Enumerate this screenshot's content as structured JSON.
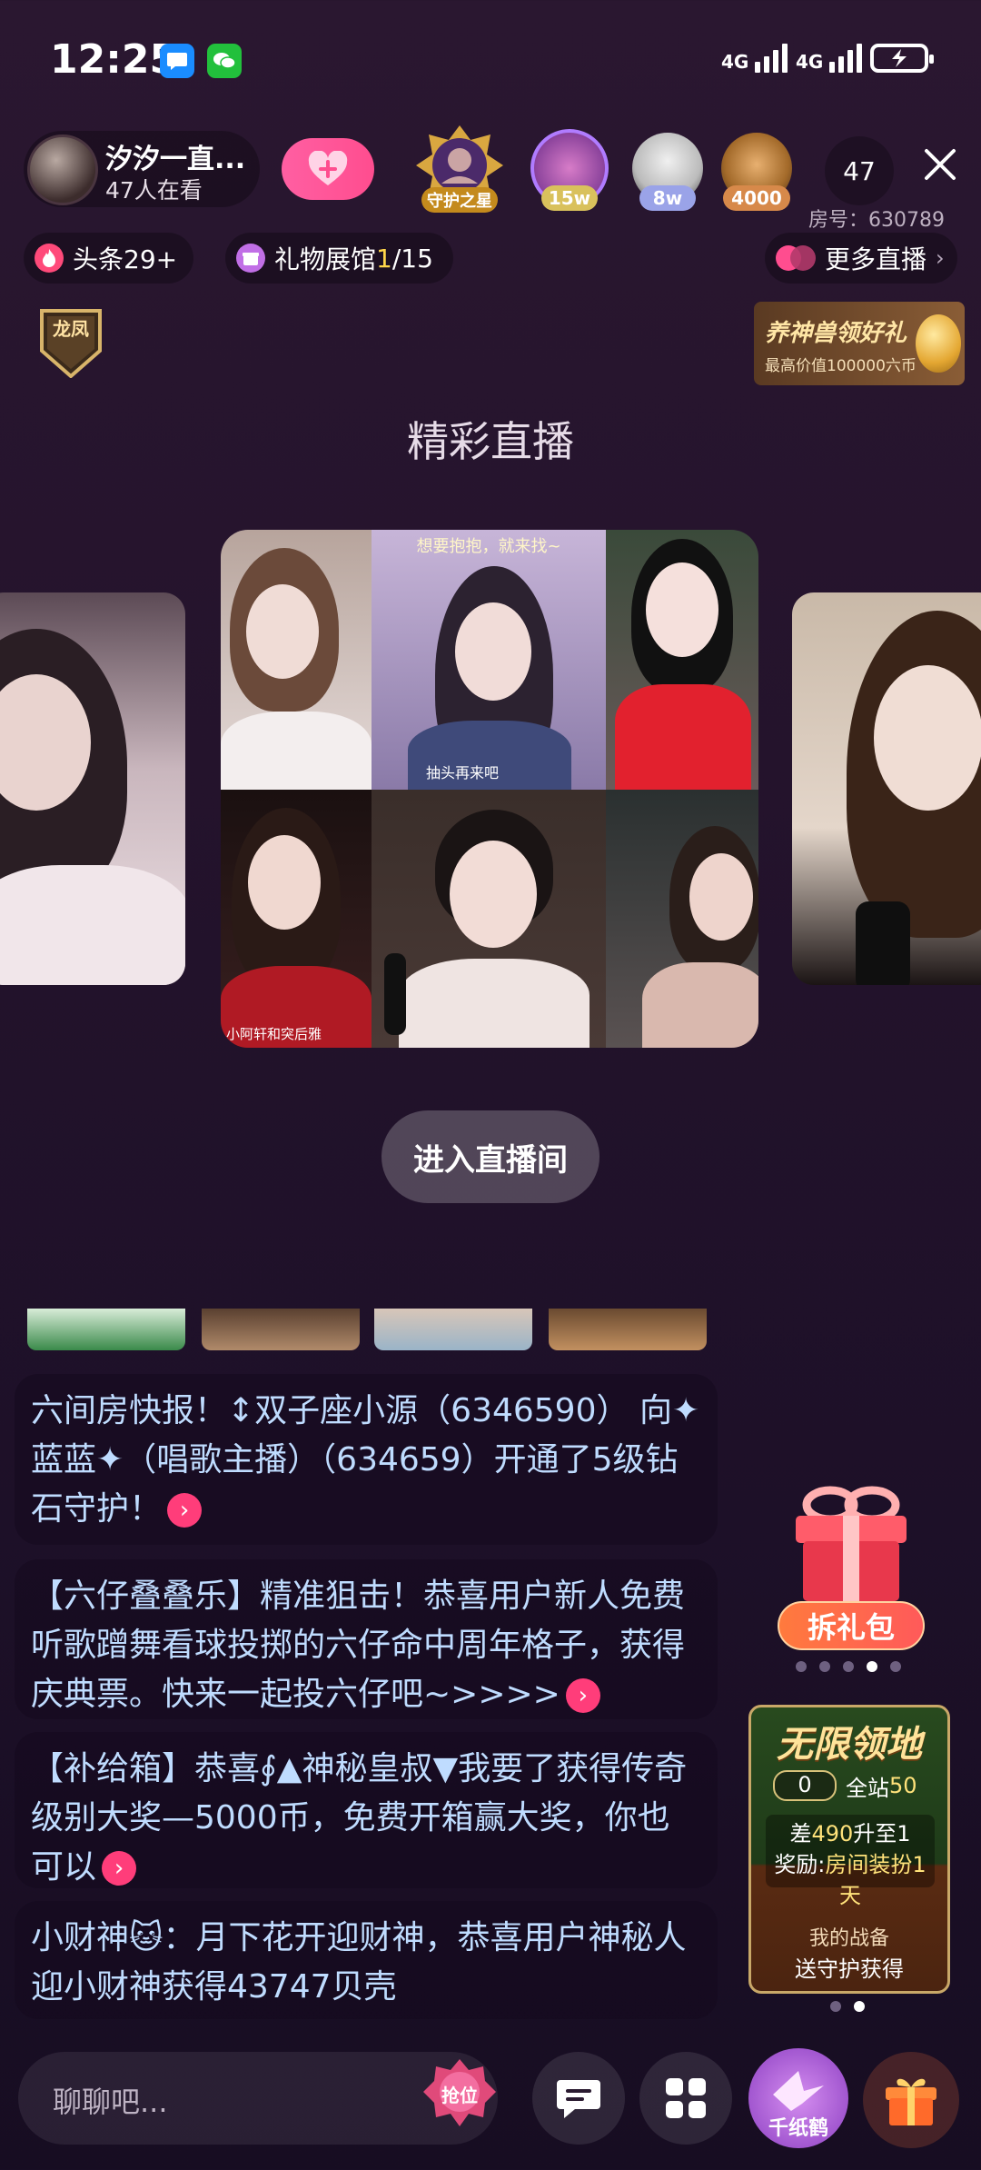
{
  "status_bar": {
    "time": "12:25",
    "network1": "4G",
    "network2": "4G"
  },
  "host": {
    "name": "汐汐一直...",
    "viewers": "47人在看"
  },
  "top_users": [
    {
      "tag": "守护之星"
    },
    {
      "tag": "15w"
    },
    {
      "tag": "8w"
    },
    {
      "tag": "4000"
    }
  ],
  "viewer_count": "47",
  "room_id": "房号：630789",
  "chips": {
    "headline": "头条29+",
    "gift_hall_label": "礼物展馆 ",
    "gift_hall_current": "1",
    "gift_hall_total": "/15",
    "more_live": "更多直播"
  },
  "dragon_badge": "龙凤",
  "promo": {
    "title": "养神兽领好礼",
    "subtitle": "最高价值100000六币"
  },
  "section_title": "精彩直播",
  "card_captions": {
    "top": "想要抱抱，就来找~",
    "bottom_left": "小阿轩和突后雅",
    "mid": "抽头再来吧"
  },
  "enter_button": "进入直播间",
  "messages": [
    {
      "text": "六间房快报！↕双子座小源（6346590） 向✦蓝蓝✦（唱歌主播）（634659）开通了5级钻石守护！"
    },
    {
      "text": "【六仔叠叠乐】精准狙击！恭喜用户新人免费听歌蹭舞看球投掷的六仔命中周年格子，获得庆典票。快来一起投六仔吧~>>>>"
    },
    {
      "text": "【补给箱】恭喜∮▲神秘皇叔▼我要了获得传奇级别大奖—5000币，免费开箱赢大奖，你也可以"
    },
    {
      "text": "小财神🐱：月下花开迎财神，恭喜用户神秘人迎小财神获得43747贝壳"
    }
  ],
  "gift_promo": {
    "label": "拆礼包"
  },
  "territory": {
    "title": "无限领地",
    "score": "0",
    "site_label": "全站",
    "site_value": "50",
    "diff_prefix": "差",
    "diff_value": "490",
    "diff_suffix": "升至1",
    "reward_prefix": "奖励:",
    "reward_value": "房间装扮1天",
    "footer1": "我的战备",
    "footer2": "送守护获得"
  },
  "bottom_bar": {
    "input_placeholder": "聊聊吧...",
    "seat_label": "抢位",
    "crane_label": "千纸鹤"
  },
  "colors": {
    "accent_pink": "#ff4d8f",
    "chat_text": "#bfdcff",
    "gold": "#ffe39a"
  }
}
